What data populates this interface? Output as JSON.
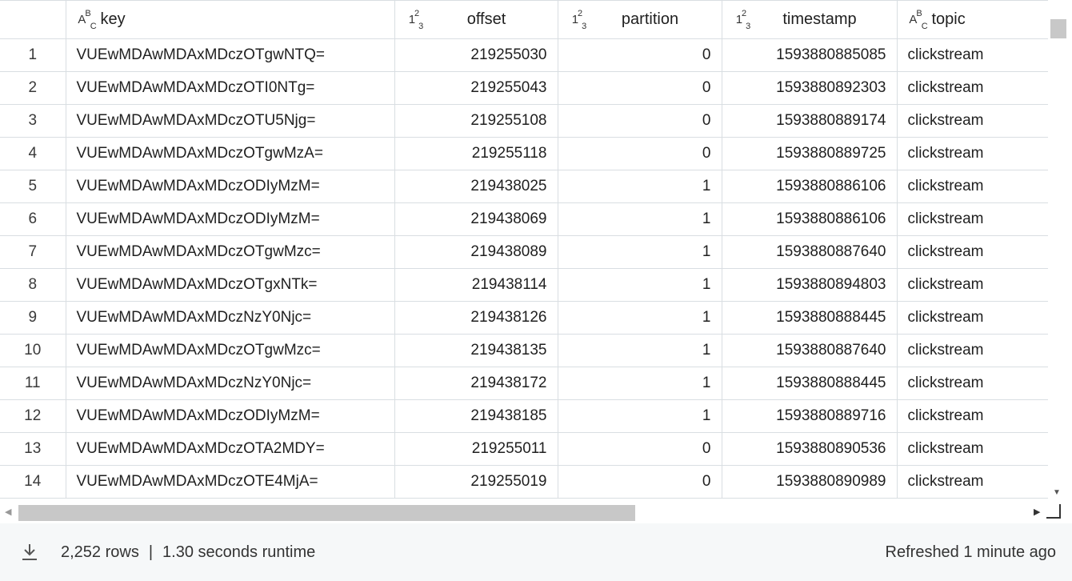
{
  "columns": [
    {
      "name": "key",
      "type_icon": "text-type-icon"
    },
    {
      "name": "offset",
      "type_icon": "number-type-icon"
    },
    {
      "name": "partition",
      "type_icon": "number-type-icon"
    },
    {
      "name": "timestamp",
      "type_icon": "number-type-icon"
    },
    {
      "name": "topic",
      "type_icon": "text-type-icon"
    }
  ],
  "rows": [
    {
      "n": "1",
      "key": "VUEwMDAwMDAxMDczOTgwNTQ=",
      "offset": "219255030",
      "partition": "0",
      "timestamp": "1593880885085",
      "topic": "clickstream"
    },
    {
      "n": "2",
      "key": "VUEwMDAwMDAxMDczOTI0NTg=",
      "offset": "219255043",
      "partition": "0",
      "timestamp": "1593880892303",
      "topic": "clickstream"
    },
    {
      "n": "3",
      "key": "VUEwMDAwMDAxMDczOTU5Njg=",
      "offset": "219255108",
      "partition": "0",
      "timestamp": "1593880889174",
      "topic": "clickstream"
    },
    {
      "n": "4",
      "key": "VUEwMDAwMDAxMDczOTgwMzA=",
      "offset": "219255118",
      "partition": "0",
      "timestamp": "1593880889725",
      "topic": "clickstream"
    },
    {
      "n": "5",
      "key": "VUEwMDAwMDAxMDczODIyMzM=",
      "offset": "219438025",
      "partition": "1",
      "timestamp": "1593880886106",
      "topic": "clickstream"
    },
    {
      "n": "6",
      "key": "VUEwMDAwMDAxMDczODIyMzM=",
      "offset": "219438069",
      "partition": "1",
      "timestamp": "1593880886106",
      "topic": "clickstream"
    },
    {
      "n": "7",
      "key": "VUEwMDAwMDAxMDczOTgwMzc=",
      "offset": "219438089",
      "partition": "1",
      "timestamp": "1593880887640",
      "topic": "clickstream"
    },
    {
      "n": "8",
      "key": "VUEwMDAwMDAxMDczOTgxNTk=",
      "offset": "219438114",
      "partition": "1",
      "timestamp": "1593880894803",
      "topic": "clickstream"
    },
    {
      "n": "9",
      "key": "VUEwMDAwMDAxMDczNzY0Njc=",
      "offset": "219438126",
      "partition": "1",
      "timestamp": "1593880888445",
      "topic": "clickstream"
    },
    {
      "n": "10",
      "key": "VUEwMDAwMDAxMDczOTgwMzc=",
      "offset": "219438135",
      "partition": "1",
      "timestamp": "1593880887640",
      "topic": "clickstream"
    },
    {
      "n": "11",
      "key": "VUEwMDAwMDAxMDczNzY0Njc=",
      "offset": "219438172",
      "partition": "1",
      "timestamp": "1593880888445",
      "topic": "clickstream"
    },
    {
      "n": "12",
      "key": "VUEwMDAwMDAxMDczODIyMzM=",
      "offset": "219438185",
      "partition": "1",
      "timestamp": "1593880889716",
      "topic": "clickstream"
    },
    {
      "n": "13",
      "key": "VUEwMDAwMDAxMDczOTA2MDY=",
      "offset": "219255011",
      "partition": "0",
      "timestamp": "1593880890536",
      "topic": "clickstream"
    },
    {
      "n": "14",
      "key": "VUEwMDAwMDAxMDczOTE4MjA=",
      "offset": "219255019",
      "partition": "0",
      "timestamp": "1593880890989",
      "topic": "clickstream"
    }
  ],
  "footer": {
    "download_icon": "download-icon",
    "row_count": "2,252 rows",
    "separator": "|",
    "runtime": "1.30 seconds runtime",
    "refreshed": "Refreshed 1 minute ago"
  },
  "colors": {
    "border": "#d9dee2",
    "footer_bg": "#f6f8f9",
    "scroll_thumb": "#c8c8c8"
  }
}
